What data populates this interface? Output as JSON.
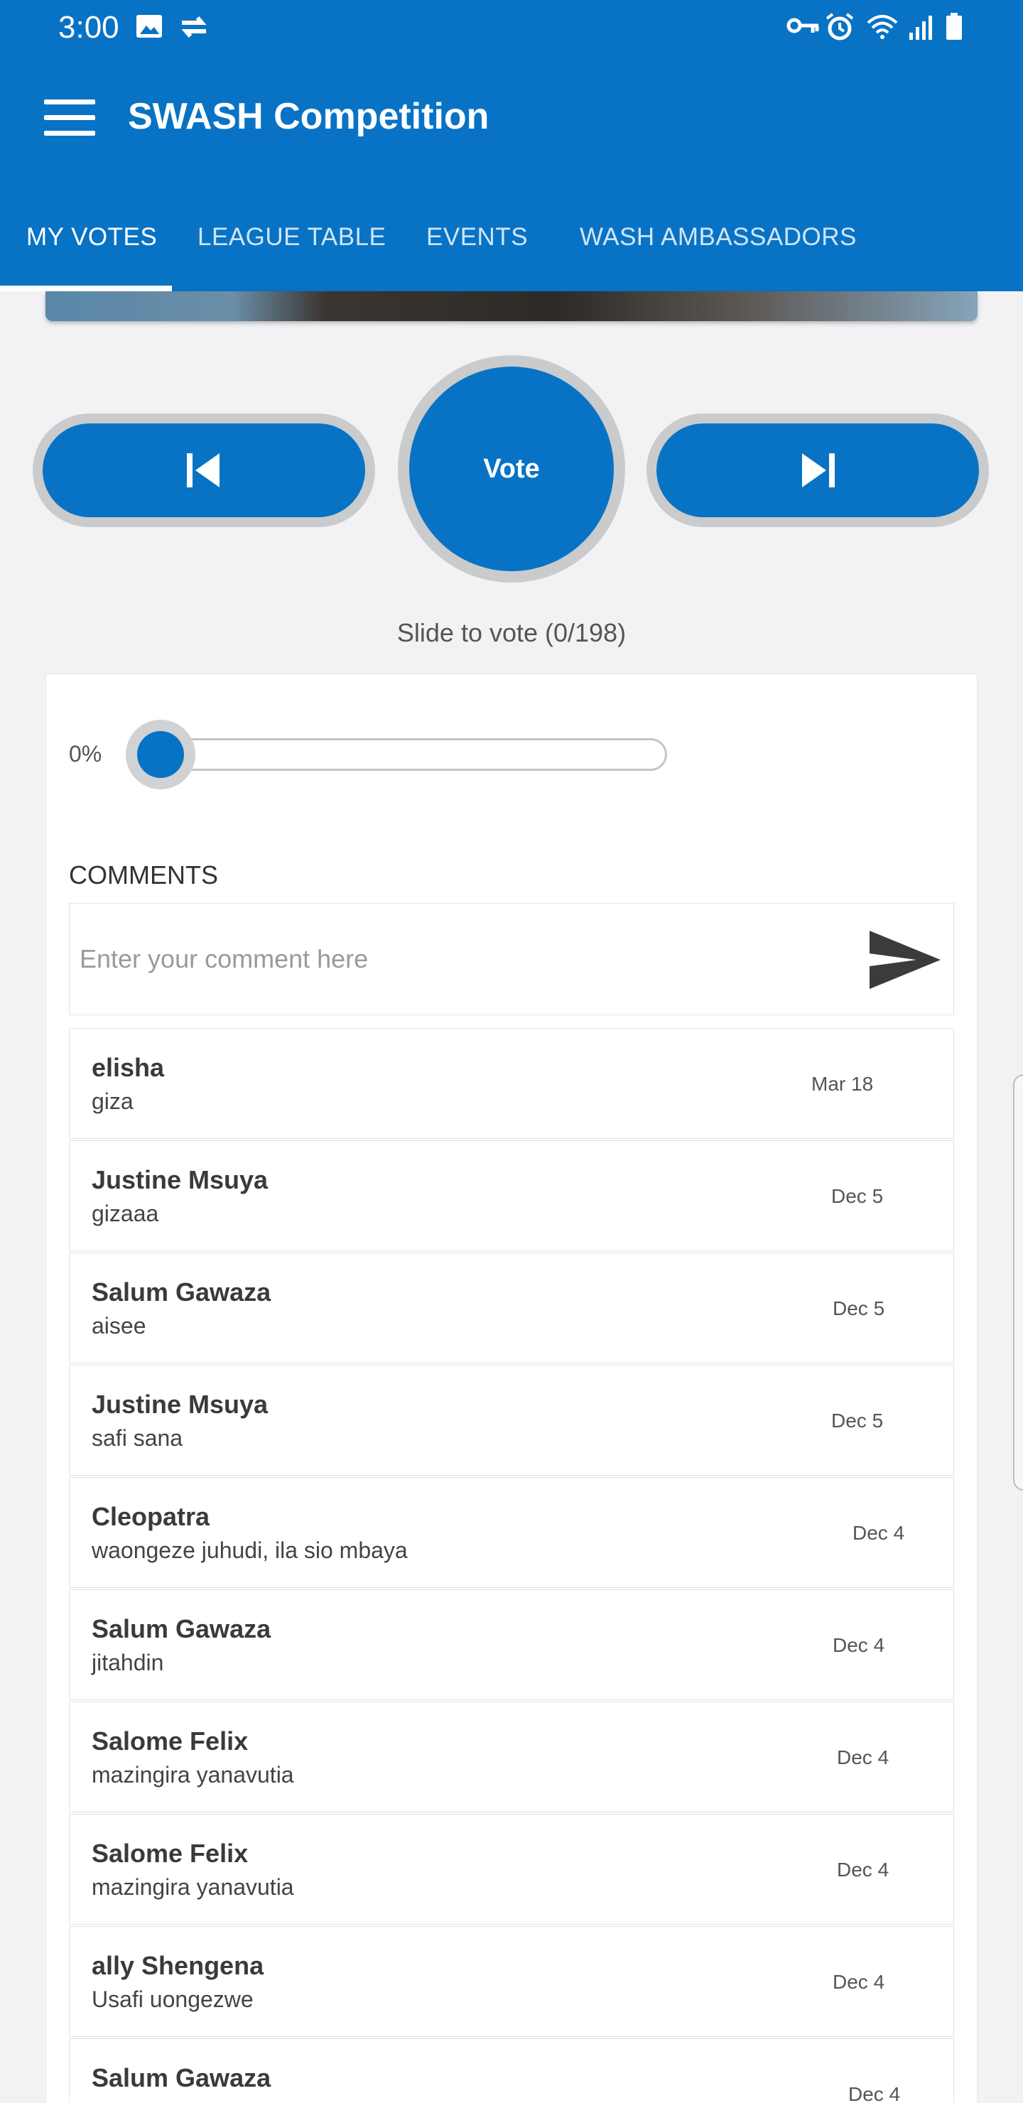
{
  "status_bar": {
    "time": "3:00"
  },
  "app": {
    "title": "SWASH Competition"
  },
  "tabs": [
    {
      "label": "MY VOTES"
    },
    {
      "label": "LEAGUE TABLE"
    },
    {
      "label": "EVENTS"
    },
    {
      "label": "WASH AMBASSADORS"
    }
  ],
  "controls": {
    "vote_label": "Vote"
  },
  "slide": {
    "label": "Slide to vote (0/198)",
    "percent_label": "0%",
    "progress": 0
  },
  "comments": {
    "title": "COMMENTS",
    "placeholder": "Enter your comment here",
    "items": [
      {
        "name": "elisha",
        "text": "giza",
        "date": "Mar 18"
      },
      {
        "name": "Justine Msuya",
        "text": "gizaaa",
        "date": "Dec 5"
      },
      {
        "name": "Salum Gawaza",
        "text": "aisee",
        "date": "Dec 5"
      },
      {
        "name": "Justine Msuya",
        "text": "safi sana",
        "date": "Dec 5"
      },
      {
        "name": "Cleopatra",
        "text": "waongeze juhudi, ila sio mbaya",
        "date": "Dec 4"
      },
      {
        "name": "Salum Gawaza",
        "text": "jitahdin",
        "date": "Dec 4"
      },
      {
        "name": "Salome Felix",
        "text": "mazingira yanavutia",
        "date": "Dec 4"
      },
      {
        "name": "Salome Felix",
        "text": "mazingira yanavutia",
        "date": "Dec 4"
      },
      {
        "name": "ally Shengena",
        "text": "Usafi uongezwe",
        "date": "Dec 4"
      },
      {
        "name": "Salum Gawaza",
        "text": "",
        "date": "Dec 4"
      }
    ]
  },
  "colors": {
    "primary": "#0873c4",
    "ring": "#c9cbcd"
  }
}
